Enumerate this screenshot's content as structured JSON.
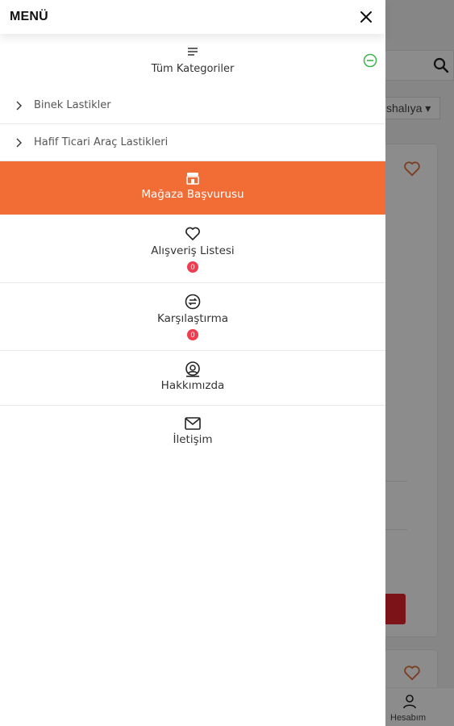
{
  "drawer": {
    "title": "MENÜ",
    "all_categories_label": "Tüm Kategoriler",
    "categories": [
      {
        "label": "Binek Lastikler"
      },
      {
        "label": "Hafif Ticari Araç Lastikleri"
      }
    ],
    "store_application_label": "Mağaza Başvurusu",
    "wishlist": {
      "label": "Alışveriş Listesi",
      "count": "0"
    },
    "compare": {
      "label": "Karşılaştırma",
      "count": "0"
    },
    "about_label": "Hakkımızda",
    "contact_label": "İletişim"
  },
  "background": {
    "sort_select": "shalıya",
    "account_label": "Hesabım"
  },
  "colors": {
    "accent": "#f26d36",
    "badge": "#ef3d4f",
    "collapse_icon": "#3db54a",
    "heart_outline": "#e0713d"
  }
}
